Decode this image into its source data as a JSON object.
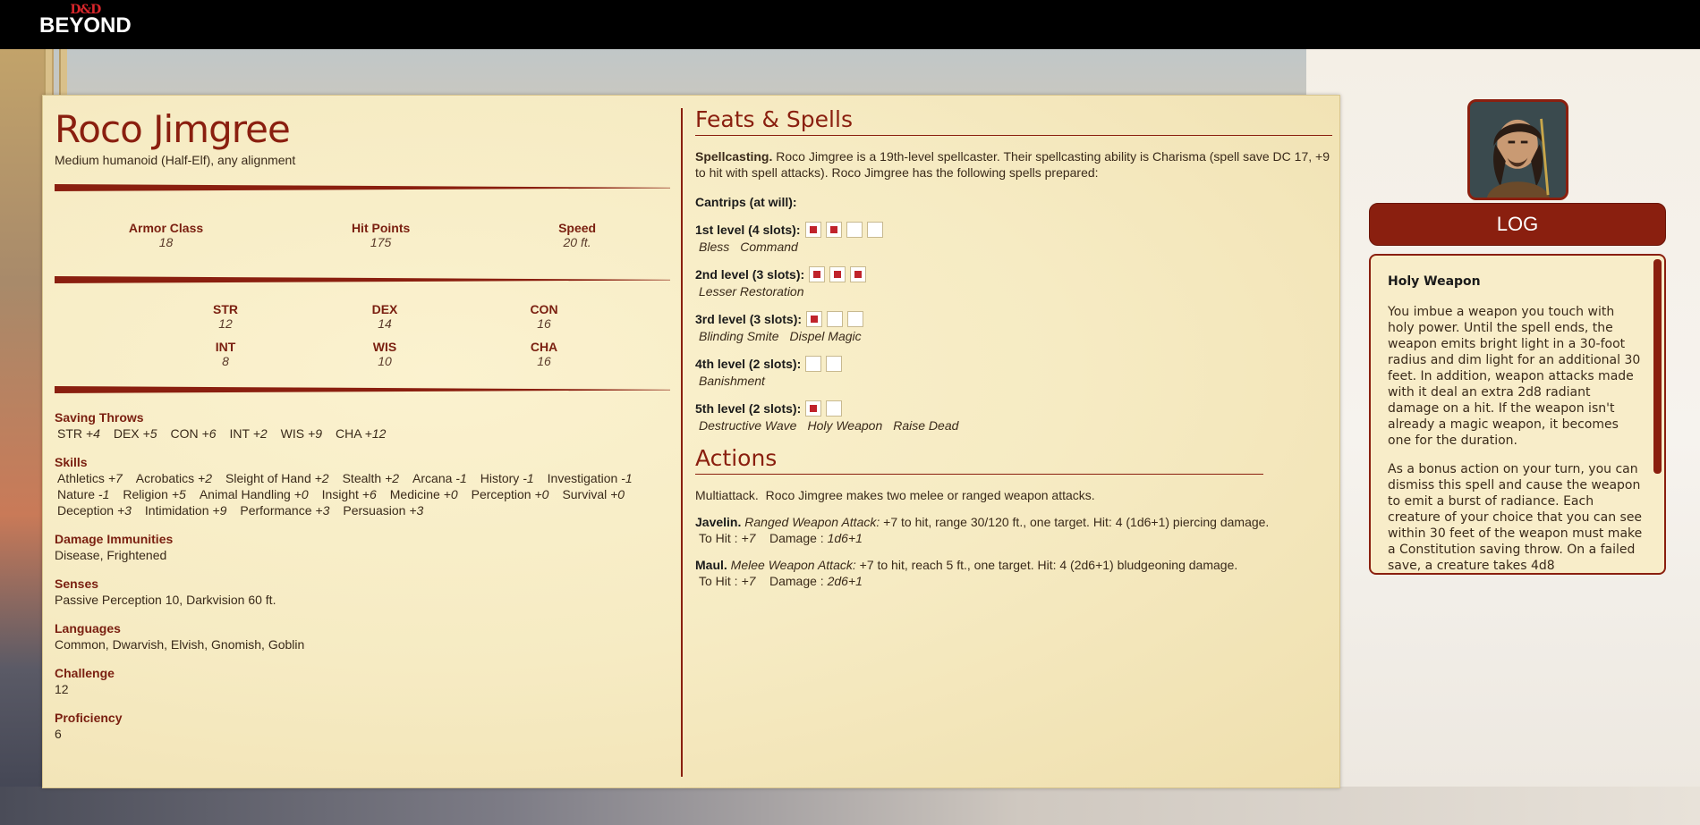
{
  "header": {
    "logo_dd": "D&D",
    "logo_beyond": "BEYOND"
  },
  "creature": {
    "name": "Roco Jimgree",
    "meta": "Medium humanoid (Half-Elf), any alignment",
    "armor_class_label": "Armor Class",
    "armor_class": "18",
    "hit_points_label": "Hit Points",
    "hit_points": "175",
    "speed_label": "Speed",
    "speed": "20 ft.",
    "abilities": [
      {
        "label": "STR",
        "value": "12"
      },
      {
        "label": "DEX",
        "value": "14"
      },
      {
        "label": "CON",
        "value": "16"
      },
      {
        "label": "INT",
        "value": "8"
      },
      {
        "label": "WIS",
        "value": "10"
      },
      {
        "label": "CHA",
        "value": "16"
      }
    ],
    "saving_throws_label": "Saving Throws",
    "saving_throws": [
      {
        "name": "STR",
        "mod": "+4"
      },
      {
        "name": "DEX",
        "mod": "+5"
      },
      {
        "name": "CON",
        "mod": "+6"
      },
      {
        "name": "INT",
        "mod": "+2"
      },
      {
        "name": "WIS",
        "mod": "+9"
      },
      {
        "name": "CHA",
        "mod": "+12"
      }
    ],
    "skills_label": "Skills",
    "skills": [
      {
        "name": "Athletics",
        "mod": "+7"
      },
      {
        "name": "Acrobatics",
        "mod": "+2"
      },
      {
        "name": "Sleight of Hand",
        "mod": "+2"
      },
      {
        "name": "Stealth",
        "mod": "+2"
      },
      {
        "name": "Arcana",
        "mod": "-1"
      },
      {
        "name": "History",
        "mod": "-1"
      },
      {
        "name": "Investigation",
        "mod": "-1"
      },
      {
        "name": "Nature",
        "mod": "-1"
      },
      {
        "name": "Religion",
        "mod": "+5"
      },
      {
        "name": "Animal Handling",
        "mod": "+0"
      },
      {
        "name": "Insight",
        "mod": "+6"
      },
      {
        "name": "Medicine",
        "mod": "+0"
      },
      {
        "name": "Perception",
        "mod": "+0"
      },
      {
        "name": "Survival",
        "mod": "+0"
      },
      {
        "name": "Deception",
        "mod": "+3"
      },
      {
        "name": "Intimidation",
        "mod": "+9"
      },
      {
        "name": "Performance",
        "mod": "+3"
      },
      {
        "name": "Persuasion",
        "mod": "+3"
      }
    ],
    "damage_immunities_label": "Damage Immunities",
    "damage_immunities": "Disease, Frightened",
    "senses_label": "Senses",
    "senses": "Passive Perception 10, Darkvision 60 ft.",
    "languages_label": "Languages",
    "languages": "Common, Dwarvish, Elvish, Gnomish, Goblin",
    "challenge_label": "Challenge",
    "challenge": "12",
    "proficiency_label": "Proficiency",
    "proficiency": "6"
  },
  "feats": {
    "title": "Feats & Spells",
    "spellcasting_label": "Spellcasting.",
    "spellcasting_text": "Roco Jimgree is a 19th-level spellcaster. Their spellcasting ability is Charisma (spell save DC 17, +9 to hit with spell attacks). Roco Jimgree has the following spells prepared:",
    "cantrips_label": "Cantrips (at will):",
    "levels": [
      {
        "label": "1st level (4 slots):",
        "slots": [
          true,
          true,
          false,
          false
        ],
        "spells": [
          "Bless",
          "Command"
        ]
      },
      {
        "label": "2nd level (3 slots):",
        "slots": [
          true,
          true,
          true
        ],
        "spells": [
          "Lesser Restoration"
        ]
      },
      {
        "label": "3rd level (3 slots):",
        "slots": [
          true,
          false,
          false
        ],
        "spells": [
          "Blinding Smite",
          "Dispel Magic"
        ]
      },
      {
        "label": "4th level (2 slots):",
        "slots": [
          false,
          false
        ],
        "spells": [
          "Banishment"
        ]
      },
      {
        "label": "5th level (2 slots):",
        "slots": [
          true,
          false
        ],
        "spells": [
          "Destructive Wave",
          "Holy Weapon",
          "Raise Dead"
        ]
      }
    ]
  },
  "actions": {
    "title": "Actions",
    "multiattack_label": "Multiattack.",
    "multiattack_text": "Roco Jimgree makes two melee or ranged weapon attacks.",
    "attacks": [
      {
        "name": "Javelin.",
        "type": "Ranged Weapon Attack:",
        "desc": "+7 to hit, range 30/120 ft., one target. Hit: 4 (1d6+1) piercing damage.",
        "to_hit_label": "To Hit :",
        "to_hit": "+7",
        "damage_label": "Damage :",
        "damage": "1d6+1"
      },
      {
        "name": "Maul.",
        "type": "Melee Weapon Attack:",
        "desc": "+7 to hit, reach 5 ft., one target. Hit: 4 (2d6+1) bludgeoning damage.",
        "to_hit_label": "To Hit :",
        "to_hit": "+7",
        "damage_label": "Damage :",
        "damage": "2d6+1"
      }
    ]
  },
  "log": {
    "button_label": "LOG",
    "entry_title": "Holy Weapon",
    "paragraphs": [
      "You imbue a weapon you touch with holy power. Until the spell ends, the weapon emits bright light in a 30-foot radius and dim light for an additional 30 feet. In addition, weapon attacks made with it deal an extra 2d8 radiant damage on a hit. If the weapon isn't already a magic weapon, it becomes one for the duration.",
      "As a bonus action on your turn, you can dismiss this spell and cause the weapon to emit a burst of radiance. Each creature of your choice that you can see within 30 feet of the weapon must make a Constitution saving throw. On a failed save, a creature takes 4d8"
    ]
  },
  "colors": {
    "accent": "#8a1f0f",
    "slot_used": "#c0232b",
    "parchment": "#f6ebc3"
  }
}
